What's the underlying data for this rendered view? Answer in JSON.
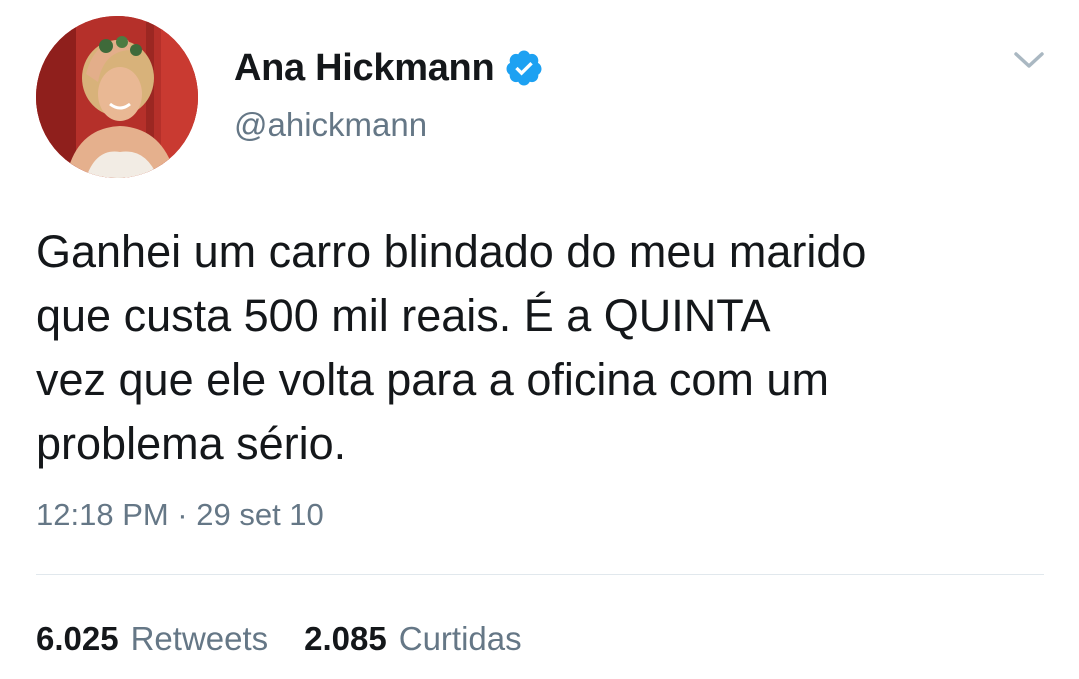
{
  "tweet": {
    "author_name": "Ana Hickmann",
    "handle": "@ahickmann",
    "text": "Ganhei um carro blindado do meu marido\nque custa 500 mil reais. É a QUINTA\nvez que ele volta para a oficina com um\nproblema sério.",
    "timestamp": "12:18 PM · 29 set 10",
    "retweets_count": "6.025",
    "retweets_label": "Retweets",
    "likes_count": "2.085",
    "likes_label": "Curtidas"
  },
  "icons": {
    "verified": "verified-badge-icon",
    "menu": "chevron-down-icon"
  },
  "colors": {
    "verified_blue": "#1da1f2",
    "text_primary": "#14171a",
    "text_secondary": "#657786",
    "divider": "#e1e8ed"
  }
}
